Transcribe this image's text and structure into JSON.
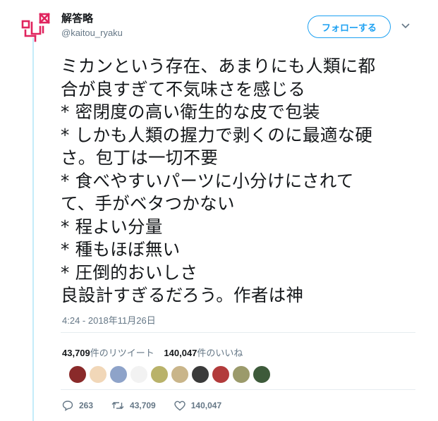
{
  "tweet": {
    "display_name": "解答略",
    "username": "@kaitou_ryaku",
    "follow_label": "フォローする",
    "text": "ミカンという存在、あまりにも人類に都\n合が良すぎて不気味さを感じる\n* 密閉度の高い衛生的な皮で包装\n* しかも人類の握力で剥くのに最適な硬\nさ。包丁は一切不要\n* 食べやすいパーツに小分けにされて\nて、手がベタつかない\n* 程よい分量\n* 種もほぼ無い\n* 圧倒的おいしさ\n良設計すぎるだろう。作者は神",
    "timestamp": "4:24 - 2018年11月26日"
  },
  "stats": {
    "retweets_count": "43,709",
    "retweets_label": "件のリツイート",
    "likes_count": "140,047",
    "likes_label": "件のいいね"
  },
  "likers": [
    {
      "name": "liker-avatar-1",
      "color": "#8a2a2a"
    },
    {
      "name": "liker-avatar-2",
      "color": "#f1d7b8"
    },
    {
      "name": "liker-avatar-3",
      "color": "#8ea3c9"
    },
    {
      "name": "liker-avatar-4",
      "color": "#f2f2f2"
    },
    {
      "name": "liker-avatar-5",
      "color": "#b9b26a"
    },
    {
      "name": "liker-avatar-6",
      "color": "#c9b58a"
    },
    {
      "name": "liker-avatar-7",
      "color": "#3a3a3a"
    },
    {
      "name": "liker-avatar-8",
      "color": "#b23b3b"
    },
    {
      "name": "liker-avatar-9",
      "color": "#9b9a6b"
    },
    {
      "name": "liker-avatar-10",
      "color": "#3d5a3a"
    }
  ],
  "actions": {
    "replies": "263",
    "retweets": "43,709",
    "likes": "140,047"
  },
  "colors": {
    "accent": "#1da1f2",
    "brand_red": "#e0245e",
    "thread_line": "#c4ecfa"
  }
}
